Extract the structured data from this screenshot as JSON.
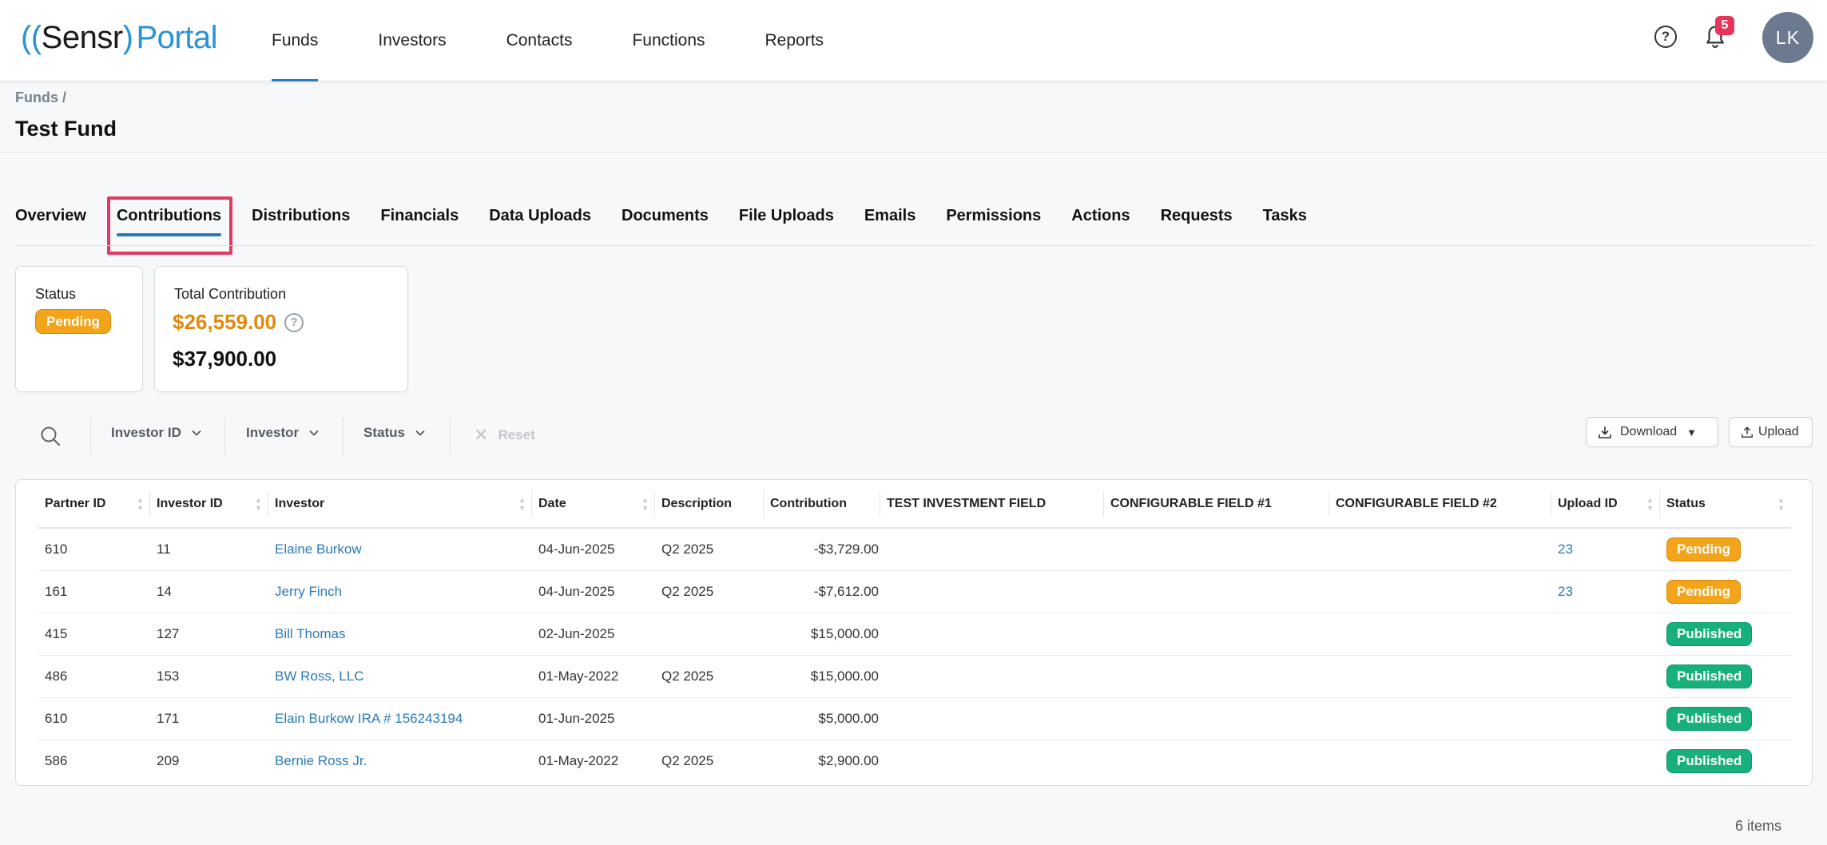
{
  "header": {
    "logo": {
      "paren_open": "((",
      "brand": "Sensr",
      "paren_close": ")",
      "portal": "Portal"
    },
    "nav": [
      {
        "label": "Funds",
        "active": true
      },
      {
        "label": "Investors"
      },
      {
        "label": "Contacts"
      },
      {
        "label": "Functions"
      },
      {
        "label": "Reports"
      }
    ],
    "help_icon": "?",
    "notification_count": "5",
    "avatar_initials": "LK"
  },
  "breadcrumb": "Funds /",
  "page_title": "Test Fund",
  "tabs": [
    {
      "label": "Overview"
    },
    {
      "label": "Contributions",
      "active": true
    },
    {
      "label": "Distributions"
    },
    {
      "label": "Financials"
    },
    {
      "label": "Data Uploads"
    },
    {
      "label": "Documents"
    },
    {
      "label": "File Uploads"
    },
    {
      "label": "Emails"
    },
    {
      "label": "Permissions"
    },
    {
      "label": "Actions"
    },
    {
      "label": "Requests"
    },
    {
      "label": "Tasks"
    }
  ],
  "summary": {
    "status_label": "Status",
    "status_value": "Pending",
    "total_label": "Total Contribution",
    "total_amount": "$26,559.00",
    "total_sub_amount": "$37,900.00",
    "help": "?"
  },
  "filters": {
    "investor_id": "Investor ID",
    "investor": "Investor",
    "status": "Status",
    "reset": "Reset",
    "reset_icon": "✕",
    "download": "Download",
    "upload": "Upload"
  },
  "table": {
    "columns": [
      "Partner ID",
      "Investor ID",
      "Investor",
      "Date",
      "Description",
      "Contribution",
      "TEST INVESTMENT FIELD",
      "CONFIGURABLE FIELD #1",
      "CONFIGURABLE FIELD #2",
      "Upload ID",
      "Status"
    ],
    "rows": [
      {
        "partner_id": "610",
        "investor_id": "11",
        "investor": "Elaine Burkow",
        "date": "04-Jun-2025",
        "description": "Q2 2025",
        "contribution": "-$3,729.00",
        "upload_id": "23",
        "status": "Pending"
      },
      {
        "partner_id": "161",
        "investor_id": "14",
        "investor": "Jerry Finch",
        "date": "04-Jun-2025",
        "description": "Q2 2025",
        "contribution": "-$7,612.00",
        "upload_id": "23",
        "status": "Pending"
      },
      {
        "partner_id": "415",
        "investor_id": "127",
        "investor": "Bill Thomas",
        "date": "02-Jun-2025",
        "description": "",
        "contribution": "$15,000.00",
        "upload_id": "",
        "status": "Published"
      },
      {
        "partner_id": "486",
        "investor_id": "153",
        "investor": "BW Ross, LLC",
        "date": "01-May-2022",
        "description": "Q2 2025",
        "contribution": "$15,000.00",
        "upload_id": "",
        "status": "Published"
      },
      {
        "partner_id": "610",
        "investor_id": "171",
        "investor": "Elain Burkow IRA # 156243194",
        "date": "01-Jun-2025",
        "description": "",
        "contribution": "$5,000.00",
        "upload_id": "",
        "status": "Published"
      },
      {
        "partner_id": "586",
        "investor_id": "209",
        "investor": "Bernie Ross Jr.",
        "date": "01-May-2022",
        "description": "Q2 2025",
        "contribution": "$2,900.00",
        "upload_id": "",
        "status": "Published"
      }
    ]
  },
  "items_count": "6 items",
  "colors": {
    "accent": "#2a7ab8",
    "pending": "#f3a41b",
    "published": "#17b07a",
    "highlight": "#e23b63",
    "amount": "#e08a0b"
  }
}
